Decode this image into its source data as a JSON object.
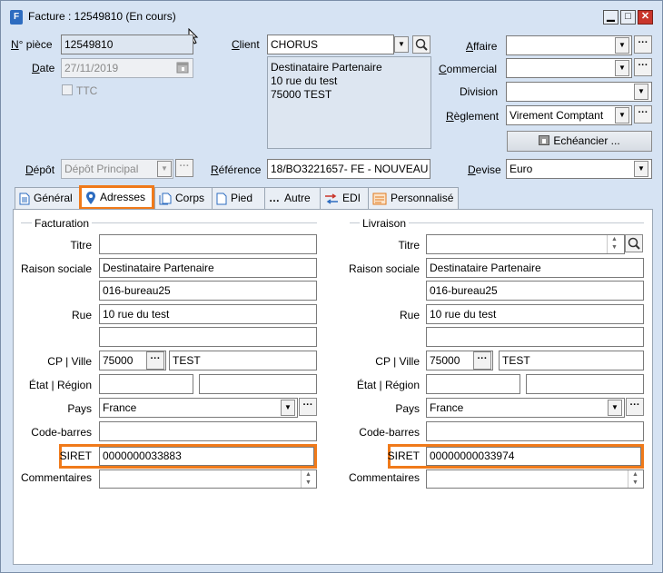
{
  "window": {
    "title": "Facture : 12549810 (En cours)",
    "app_icon": "F",
    "controls": {
      "minimize": "▁",
      "maximize": "□",
      "close": "✕"
    }
  },
  "header": {
    "num_piece_label": "N° pièce",
    "num_piece_value": "12549810",
    "date_label": "Date",
    "date_value": "27/11/2019",
    "ttc_label": "TTC",
    "depot_label": "Dépôt",
    "depot_value": "Dépôt Principal",
    "client_label": "Client",
    "client_value": "CHORUS",
    "client_address": [
      "Destinataire Partenaire",
      "10 rue du test",
      "75000 TEST"
    ],
    "reference_label": "Référence",
    "reference_value": "18/BO3221657- FE - NOUVEAU H",
    "affaire_label": "Affaire",
    "affaire_value": "",
    "commercial_label": "Commercial",
    "commercial_value": "",
    "division_label": "Division",
    "division_value": "",
    "reglement_label": "Règlement",
    "reglement_value": "Virement Comptant",
    "echeancier_label": "Echéancier ...",
    "devise_label": "Devise",
    "devise_value": "Euro"
  },
  "tabs": [
    {
      "label": "Général",
      "icon": "document-icon"
    },
    {
      "label": "Adresses",
      "icon": "location-pin-icon",
      "active": true
    },
    {
      "label": "Corps",
      "icon": "pages-icon"
    },
    {
      "label": "Pied",
      "icon": "page-icon"
    },
    {
      "label": "Autre",
      "icon": "ellipsis-icon"
    },
    {
      "label": "EDI",
      "icon": "edi-icon"
    },
    {
      "label": "Personnalisé",
      "icon": "custom-fields-icon"
    }
  ],
  "labels": {
    "titre": "Titre",
    "raison_sociale": "Raison sociale",
    "rue": "Rue",
    "cp_ville": "CP | Ville",
    "etat_region": "État | Région",
    "pays": "Pays",
    "code_barres": "Code-barres",
    "siret": "SIRET",
    "commentaires": "Commentaires"
  },
  "facturation": {
    "title": "Facturation",
    "titre": "",
    "raison_sociale": "Destinataire Partenaire",
    "raison_sociale_2": "016-bureau25",
    "rue": "10 rue du test",
    "rue_2": "",
    "cp": "75000",
    "ville": "TEST",
    "etat": "",
    "region": "",
    "pays": "France",
    "code_barres": "",
    "siret": "0000000033883",
    "commentaires": ""
  },
  "livraison": {
    "title": "Livraison",
    "titre": "",
    "raison_sociale": "Destinataire Partenaire",
    "raison_sociale_2": "016-bureau25",
    "rue": "10 rue du test",
    "rue_2": "",
    "cp": "75000",
    "ville": "TEST",
    "etat": "",
    "region": "",
    "pays": "France",
    "code_barres": "",
    "siret": "00000000033974",
    "commentaires": ""
  },
  "colors": {
    "highlight": "#f07a1a",
    "window_bg": "#d6e3f3"
  }
}
